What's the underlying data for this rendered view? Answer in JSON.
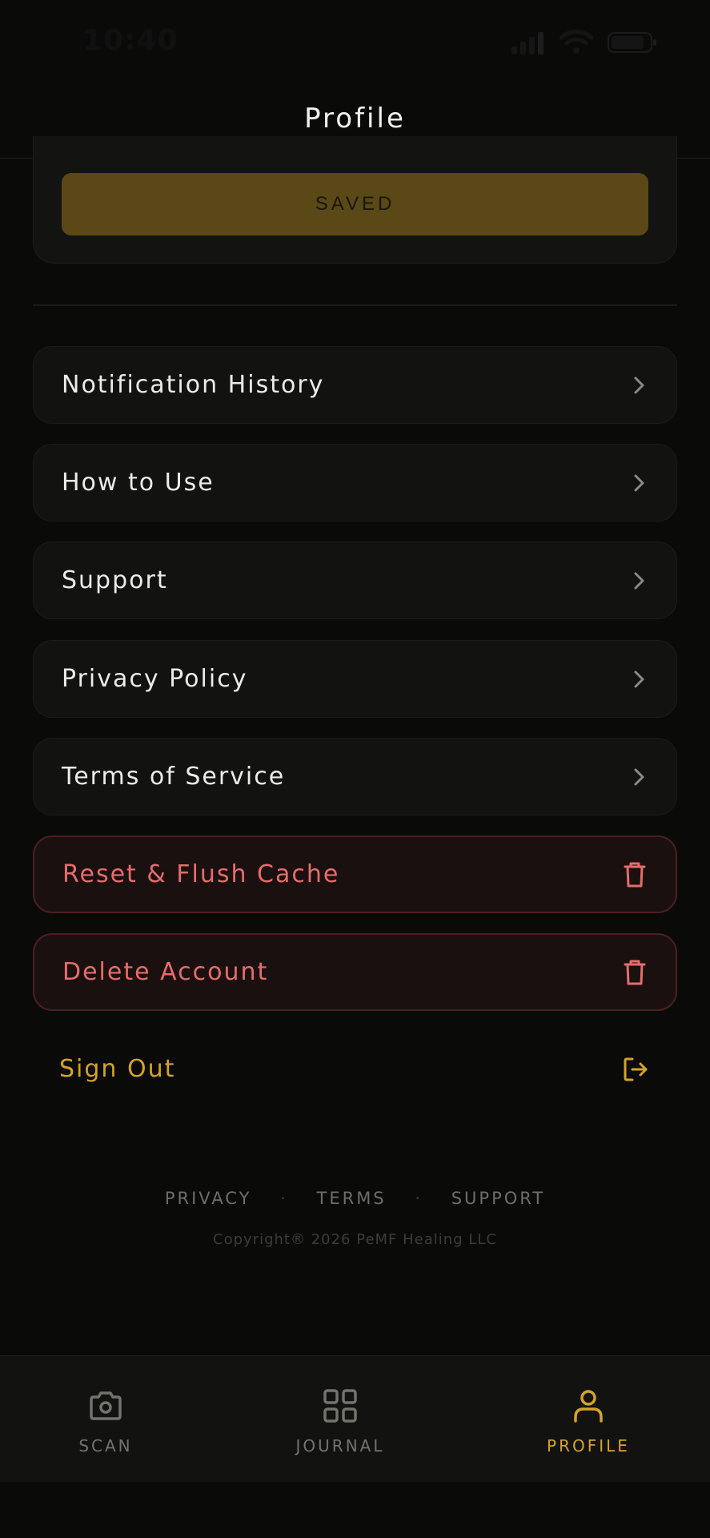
{
  "status_bar": {
    "time": "10:40"
  },
  "header": {
    "title": "Profile"
  },
  "settings": {
    "saved_label": "SAVED"
  },
  "menu": [
    {
      "label": "Notification History",
      "icon": "chevron-right-icon"
    },
    {
      "label": "How to Use",
      "icon": "chevron-right-icon"
    },
    {
      "label": "Support",
      "icon": "chevron-right-icon"
    },
    {
      "label": "Privacy Policy",
      "icon": "chevron-right-icon"
    },
    {
      "label": "Terms of Service",
      "icon": "chevron-right-icon"
    }
  ],
  "danger_actions": [
    {
      "label": "Reset & Flush Cache",
      "icon": "trash-icon"
    },
    {
      "label": "Delete Account",
      "icon": "trash-icon"
    }
  ],
  "sign_out": {
    "label": "Sign Out",
    "icon": "log-out-icon"
  },
  "footer": {
    "links": [
      "PRIVACY",
      "TERMS",
      "SUPPORT"
    ],
    "separator": "·",
    "copyright": "Copyright® 2026 PeMF Healing LLC"
  },
  "tabs": [
    {
      "label": "SCAN",
      "icon": "camera-icon",
      "active": false
    },
    {
      "label": "JOURNAL",
      "icon": "grid-icon",
      "active": false
    },
    {
      "label": "PROFILE",
      "icon": "user-icon",
      "active": true
    }
  ],
  "colors": {
    "background": "#0a0a09",
    "accent": "#d4a227",
    "danger": "#e66c6c",
    "saved_button": "#5a4816"
  }
}
